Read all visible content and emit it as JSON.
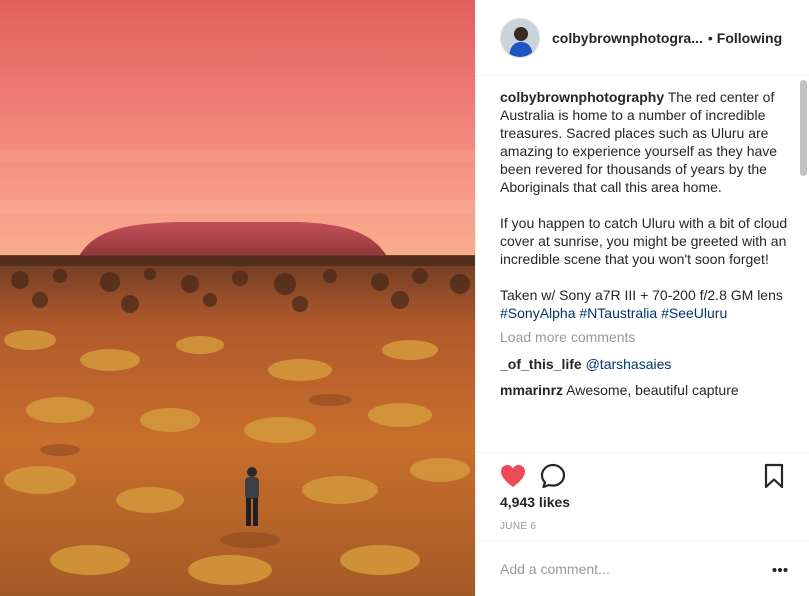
{
  "post": {
    "photo_alt": "Uluru at sunrise with a hiker in the red desert",
    "author": "colbybrownphotogra...",
    "follow_status": "Following",
    "separator": "•"
  },
  "caption": {
    "user": "colbybrownphotography",
    "text": " The red center of Australia is home to a number of incredible treasures. Sacred places such as Uluru are amazing to experience yourself as they have been revered for thousands of years by the Aboriginals that call this area home.\n\nIf you happen to catch Uluru with a bit of cloud cover at sunrise, you might be greeted with an incredible scene that you won't soon forget!\n\nTaken w/ Sony a7R III + 70-200 f/2.8 GM lens",
    "hashtags": "#SonyAlpha #NTaustralia #SeeUluru"
  },
  "load_more": "Load more comments",
  "comments": [
    {
      "user": "_of_this_life",
      "text": " ",
      "mention": "@tarshasaies"
    },
    {
      "user": "mmarinrz",
      "text": " Awesome, beautiful capture",
      "mention": ""
    }
  ],
  "likes": "4,943 likes",
  "date": "JUNE 6",
  "add_comment_placeholder": "Add a comment...",
  "colors": {
    "like_red": "#ed4956",
    "link_blue": "#003569",
    "muted_gray": "#999999"
  },
  "icons": {
    "like": "heart-icon",
    "comment": "comment-bubble-icon",
    "save": "bookmark-icon",
    "more": "more-options-icon"
  }
}
